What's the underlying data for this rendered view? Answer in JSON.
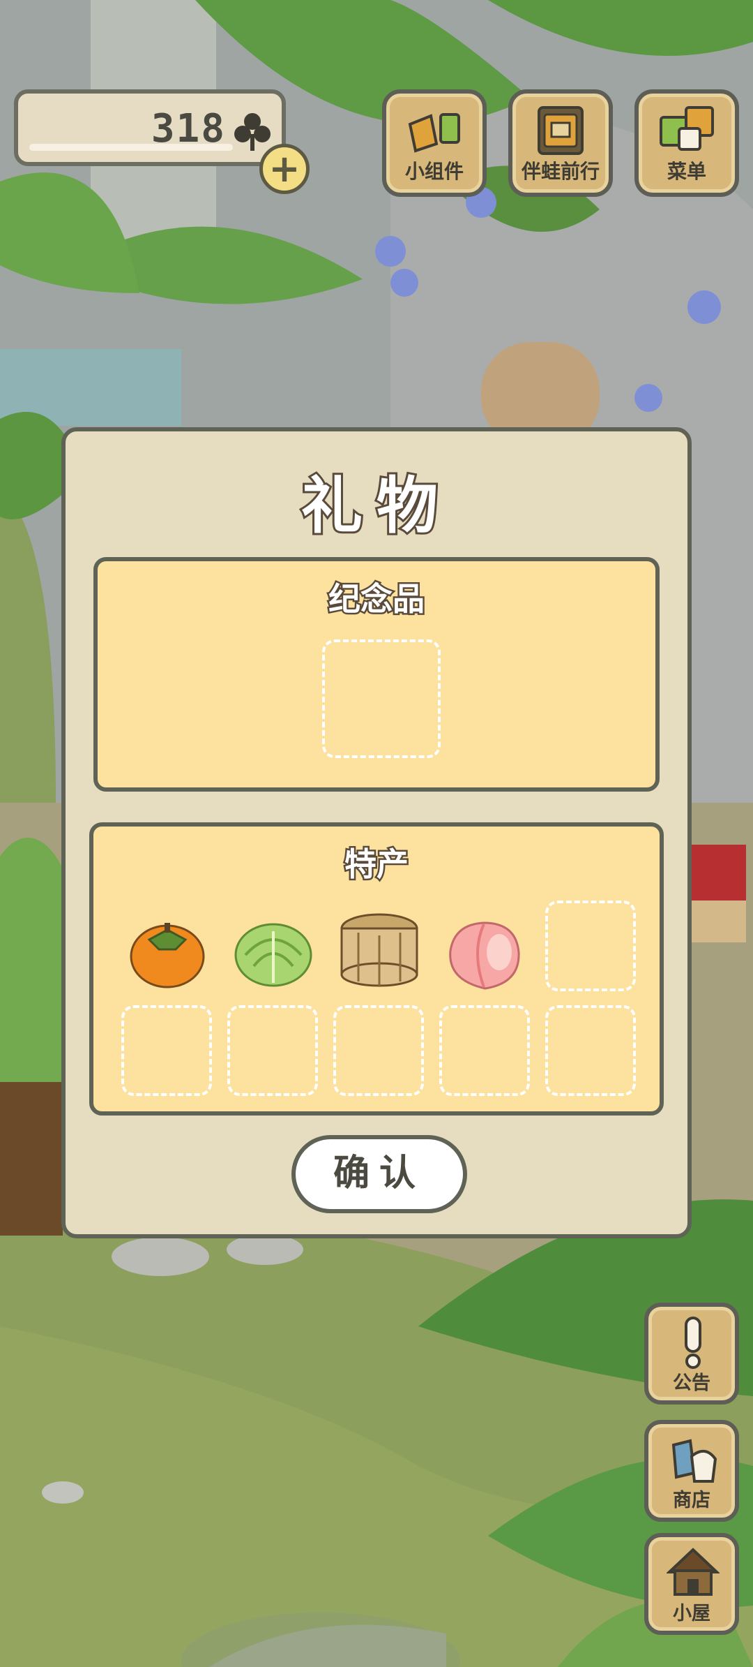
{
  "hud": {
    "clover_count": "318",
    "add_symbol": "+"
  },
  "top_menu": [
    {
      "label": "小组件",
      "icon": "widget-icon"
    },
    {
      "label": "伴蛙前行",
      "icon": "photo-album-icon"
    },
    {
      "label": "菜单",
      "icon": "menu-cards-icon"
    }
  ],
  "side_menu": [
    {
      "label": "公告",
      "icon": "exclamation-icon"
    },
    {
      "label": "商店",
      "icon": "shop-bags-icon"
    },
    {
      "label": "小屋",
      "icon": "house-icon"
    }
  ],
  "dialog": {
    "title": "礼物",
    "souvenir": {
      "title": "纪念品",
      "slots": 1
    },
    "specialty": {
      "title": "特产",
      "items": [
        "persimmon-item",
        "cabbage-item",
        "natto-bucket-item",
        "peach-item"
      ],
      "empty_slots": 6
    },
    "confirm_label": "确认"
  },
  "colors": {
    "panel": "#e6dcc0",
    "section": "#fde19e",
    "border": "#5f6356",
    "wood": "#d7b77a"
  }
}
